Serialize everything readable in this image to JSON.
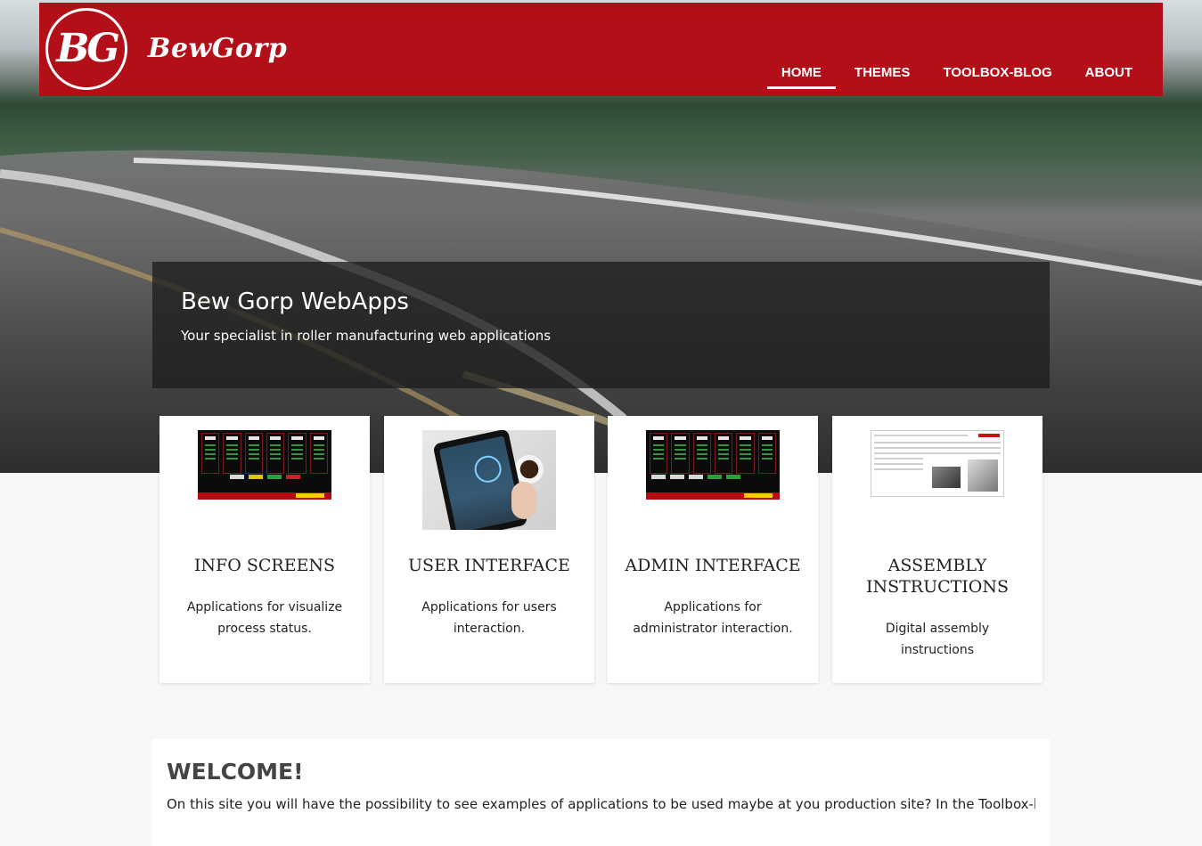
{
  "header": {
    "logo_initials": "BG",
    "brand": "BewGorp",
    "nav": [
      {
        "label": "HOME",
        "active": true
      },
      {
        "label": "THEMES",
        "active": false
      },
      {
        "label": "TOOLBOX-BLOG",
        "active": false
      },
      {
        "label": "ABOUT",
        "active": false
      }
    ]
  },
  "hero": {
    "title": "Bew Gorp WebApps",
    "subtitle": "Your specialist in roller manufacturing web applications"
  },
  "cards": [
    {
      "title": "INFO SCREENS",
      "description": "Applications for visualize process status.",
      "image": "dashboard-screenshot"
    },
    {
      "title": "USER INTERFACE",
      "description": "Applications for users interaction.",
      "image": "tablet-photo"
    },
    {
      "title": "ADMIN INTERFACE",
      "description": "Applications for administrator interaction.",
      "image": "dashboard-screenshot"
    },
    {
      "title": "ASSEMBLY INSTRUCTIONS",
      "description": "Digital assembly instructions",
      "image": "document-screenshot"
    }
  ],
  "welcome": {
    "heading": "WELCOME!",
    "text": "On this site you will have the possibility to see examples of applications to be used maybe at you production site? In the Toolbox-blog"
  },
  "colors": {
    "brand_red": "#b20f18",
    "page_bg": "#f7f7f7"
  }
}
